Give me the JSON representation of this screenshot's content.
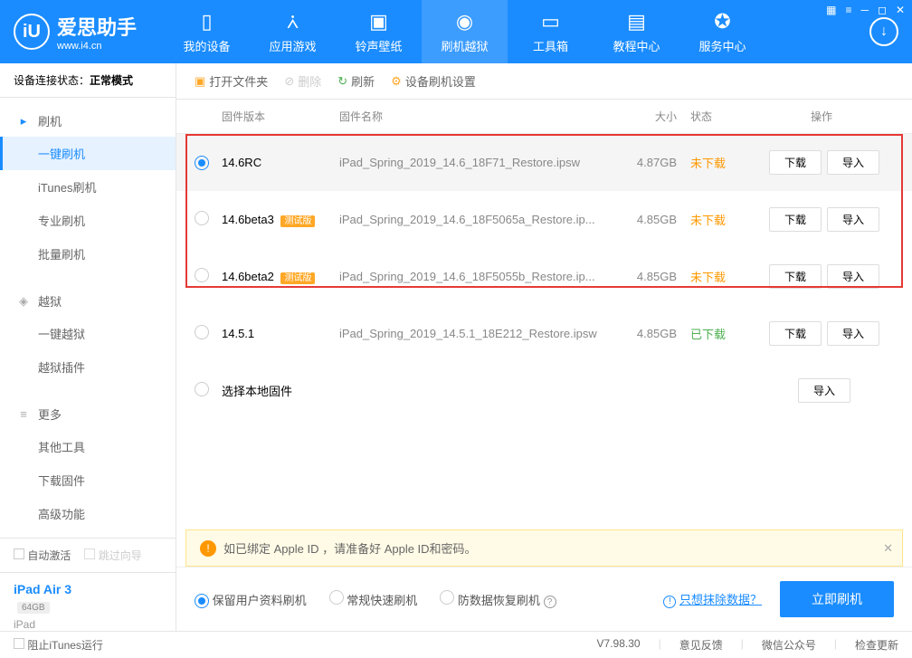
{
  "app": {
    "name": "爱思助手",
    "url": "www.i4.cn"
  },
  "nav": {
    "items": [
      {
        "label": "我的设备"
      },
      {
        "label": "应用游戏"
      },
      {
        "label": "铃声壁纸"
      },
      {
        "label": "刷机越狱"
      },
      {
        "label": "工具箱"
      },
      {
        "label": "教程中心"
      },
      {
        "label": "服务中心"
      }
    ]
  },
  "status": {
    "label": "设备连接状态：",
    "value": "正常模式"
  },
  "sidebar": {
    "groups": [
      {
        "title": "刷机",
        "items": [
          "一键刷机",
          "iTunes刷机",
          "专业刷机",
          "批量刷机"
        ]
      },
      {
        "title": "越狱",
        "items": [
          "一键越狱",
          "越狱插件"
        ]
      },
      {
        "title": "更多",
        "items": [
          "其他工具",
          "下载固件",
          "高级功能"
        ]
      }
    ],
    "auto_activate": "自动激活",
    "skip_guide": "跳过向导",
    "device": {
      "name": "iPad Air 3",
      "storage": "64GB",
      "type": "iPad"
    }
  },
  "toolbar": {
    "open": "打开文件夹",
    "delete": "删除",
    "refresh": "刷新",
    "settings": "设备刷机设置"
  },
  "table": {
    "headers": {
      "version": "固件版本",
      "name": "固件名称",
      "size": "大小",
      "status": "状态",
      "action": "操作"
    },
    "rows": [
      {
        "version": "14.6RC",
        "beta": false,
        "name": "iPad_Spring_2019_14.6_18F71_Restore.ipsw",
        "size": "4.87GB",
        "status": "未下载",
        "status_class": "orange",
        "selected": true,
        "download": true
      },
      {
        "version": "14.6beta3",
        "beta": true,
        "name": "iPad_Spring_2019_14.6_18F5065a_Restore.ip...",
        "size": "4.85GB",
        "status": "未下载",
        "status_class": "orange",
        "selected": false,
        "download": true
      },
      {
        "version": "14.6beta2",
        "beta": true,
        "name": "iPad_Spring_2019_14.6_18F5055b_Restore.ip...",
        "size": "4.85GB",
        "status": "未下载",
        "status_class": "orange",
        "selected": false,
        "download": true
      },
      {
        "version": "14.5.1",
        "beta": false,
        "name": "iPad_Spring_2019_14.5.1_18E212_Restore.ipsw",
        "size": "4.85GB",
        "status": "已下载",
        "status_class": "green",
        "selected": false,
        "download": true
      },
      {
        "version": "选择本地固件",
        "beta": false,
        "name": "",
        "size": "",
        "status": "",
        "status_class": "",
        "selected": false,
        "download": false
      }
    ],
    "beta_label": "测试版",
    "btn_download": "下载",
    "btn_import": "导入"
  },
  "banner": {
    "text": "如已绑定 Apple ID ，请准备好 Apple ID和密码。"
  },
  "flash": {
    "opt1": "保留用户资料刷机",
    "opt2": "常规快速刷机",
    "opt3": "防数据恢复刷机",
    "erase_link": "只想抹除数据？",
    "flash_btn": "立即刷机"
  },
  "footer": {
    "block_itunes": "阻止iTunes运行",
    "version": "V7.98.30",
    "feedback": "意见反馈",
    "wechat": "微信公众号",
    "update": "检查更新"
  }
}
